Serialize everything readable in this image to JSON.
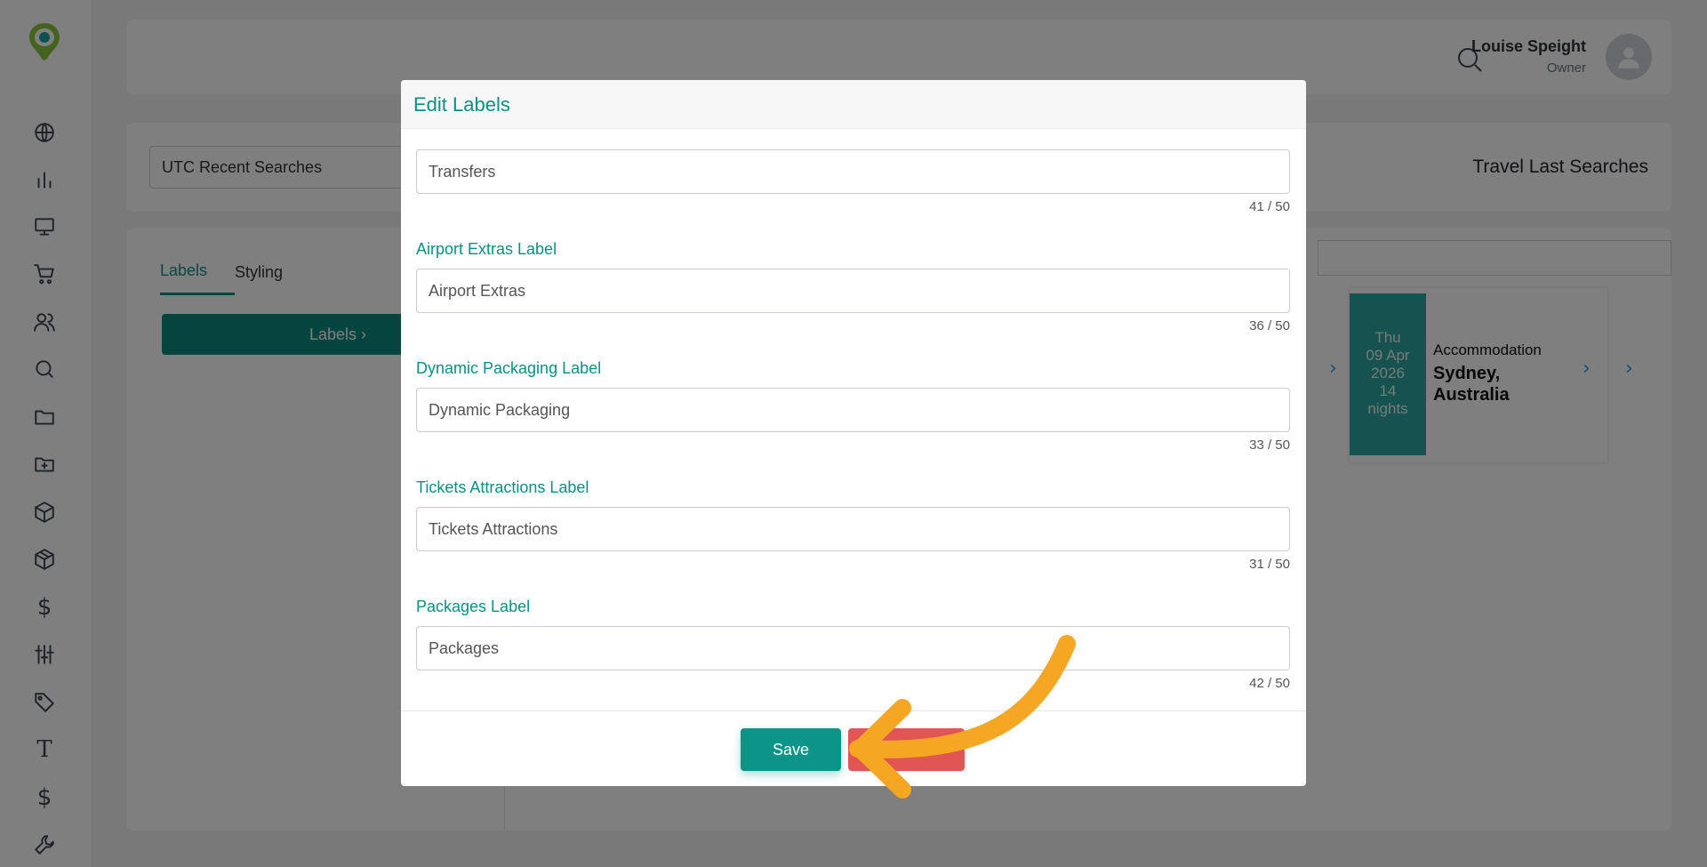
{
  "user": {
    "name": "Louise Speight",
    "role": "Owner"
  },
  "search": {
    "selected": "UTC Recent Searches",
    "title": "Travel Last Searches"
  },
  "tabs": [
    {
      "label": "Labels"
    },
    {
      "label": "Styling"
    }
  ],
  "labels_button": "Labels ›",
  "result": {
    "day": "Thu",
    "date": "09 Apr",
    "year": "2026",
    "nights_count": "14",
    "nights_word": "nights",
    "type": "Accommodation",
    "city": "Sydney, Australia"
  },
  "modal": {
    "title": "Edit Labels",
    "fields": [
      {
        "label": "",
        "value": "Transfers",
        "count": "41 / 50"
      },
      {
        "label": "Airport Extras Label",
        "value": "Airport Extras",
        "count": "36 / 50"
      },
      {
        "label": "Dynamic Packaging Label",
        "value": "Dynamic Packaging",
        "count": "33 / 50"
      },
      {
        "label": "Tickets Attractions Label",
        "value": "Tickets Attractions",
        "count": "31 / 50"
      },
      {
        "label": "Packages Label",
        "value": "Packages",
        "count": "42 / 50"
      }
    ],
    "save_label": "Save",
    "cancel_label": ""
  },
  "colors": {
    "accent": "#0a8f84",
    "save": "#0d9488",
    "cancel": "#e25555",
    "annotation_arrow": "#f5a623"
  }
}
